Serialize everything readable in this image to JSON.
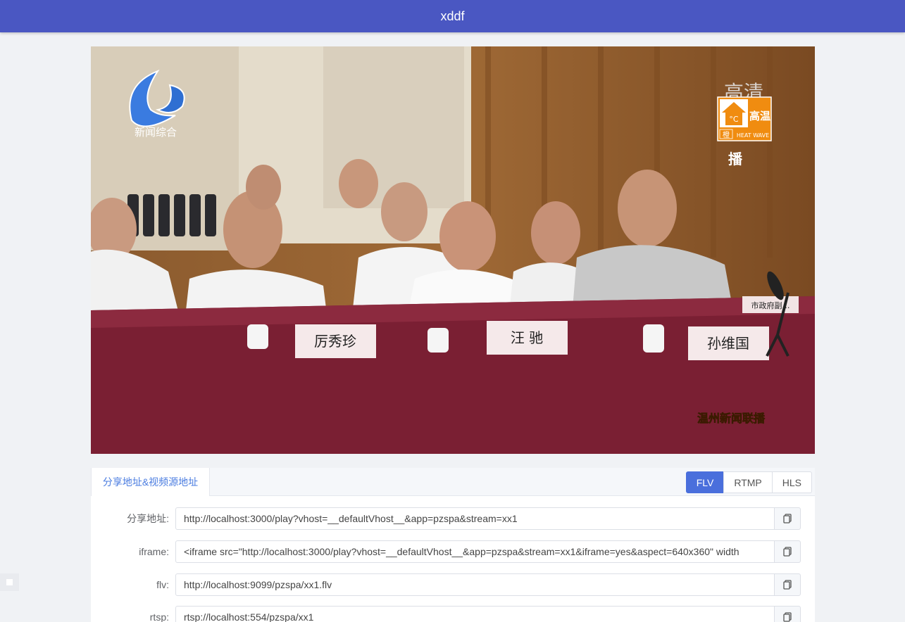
{
  "header": {
    "title": "xddf"
  },
  "player": {
    "channel_logo_text": "新闻综合",
    "hd_badge": "高清",
    "weather_badge": {
      "temp_icon": "°C",
      "warning": "高温",
      "level": "橙",
      "label": "HEAT WAVE"
    },
    "broadcast_text": "播",
    "program_caption": "温州新闻联播",
    "name_cards": [
      "厉秀珍",
      "汪 驰",
      "孙维国"
    ],
    "side_sign": "市政府副…"
  },
  "panel": {
    "tab_label": "分享地址&视频源地址",
    "protocols": [
      "FLV",
      "RTMP",
      "HLS"
    ],
    "active_protocol": "FLV",
    "rows": [
      {
        "label": "分享地址:",
        "value": "http://localhost:3000/play?vhost=__defaultVhost__&app=pzspa&stream=xx1"
      },
      {
        "label": "iframe:",
        "value": "<iframe src=\"http://localhost:3000/play?vhost=__defaultVhost__&app=pzspa&stream=xx1&iframe=yes&aspect=640x360\" width"
      },
      {
        "label": "flv:",
        "value": "http://localhost:9099/pzspa/xx1.flv"
      },
      {
        "label": "rtsp:",
        "value": "rtsp://localhost:554/pzspa/xx1"
      }
    ]
  },
  "icons": {
    "copy": "copy-icon"
  },
  "colors": {
    "header": "#4a57c2",
    "accent": "#4a6fdc",
    "tab_text": "#4a7ce0"
  }
}
